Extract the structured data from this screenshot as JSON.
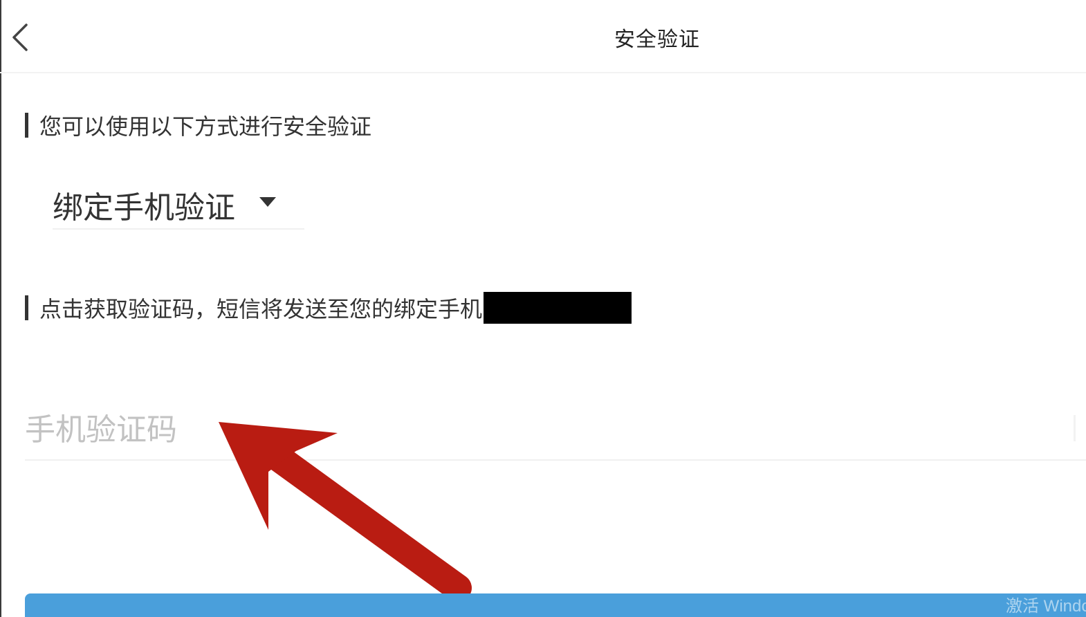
{
  "nav": {
    "title": "安全验证",
    "back_icon": "chevron-left-icon"
  },
  "section_methods": {
    "label": "您可以使用以下方式进行安全验证"
  },
  "method_select": {
    "selected": "绑定手机验证",
    "caret_icon": "caret-down-icon"
  },
  "section_code": {
    "label": "点击获取验证码，短信将发送至您的绑定手机",
    "phone_redacted": true
  },
  "code_input": {
    "value": "",
    "placeholder": "手机验证码"
  },
  "annotation": {
    "arrow_icon": "red-arrow-icon",
    "arrow_color": "#b91c12"
  },
  "submit": {
    "label": "",
    "color": "#4a9fdb"
  },
  "watermark": {
    "text": "激活 Windo"
  }
}
